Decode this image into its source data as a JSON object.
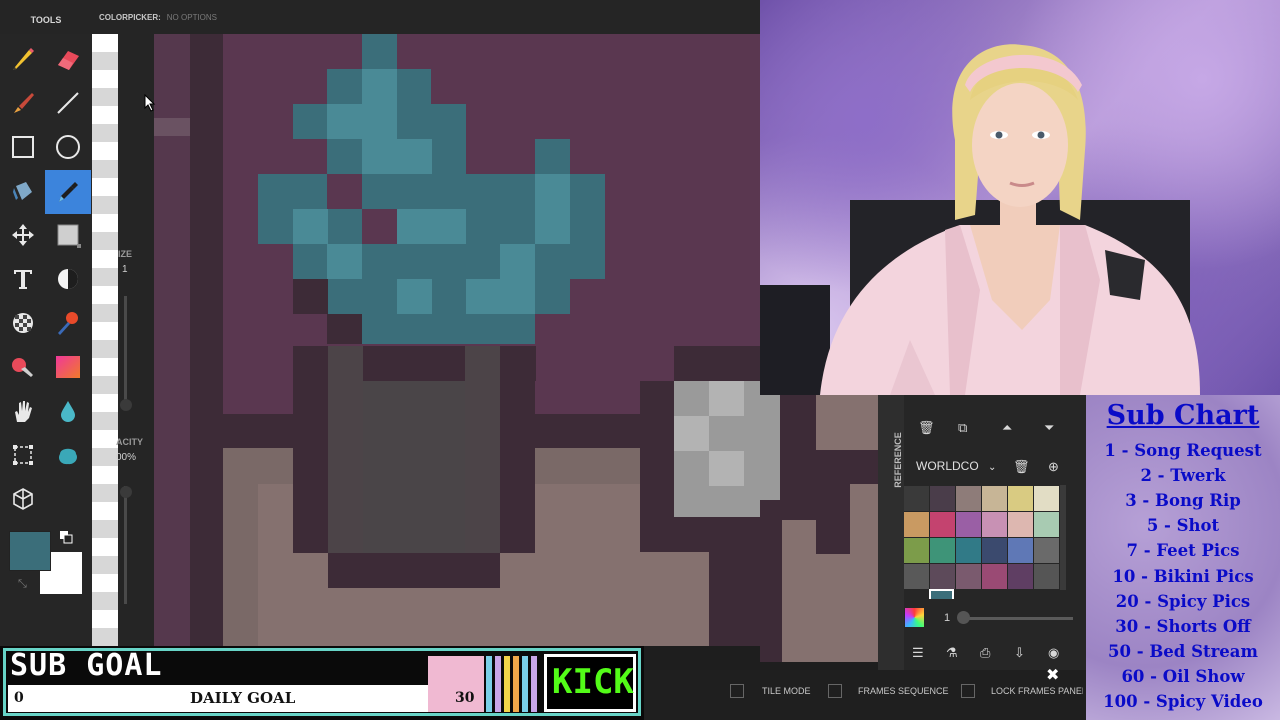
{
  "editor": {
    "tools_title": "TOOLS",
    "tool_option_name": "COLORPICKER:",
    "tool_option_value": "NO OPTIONS",
    "size_label": "IZE",
    "size_value": "1",
    "opacity_label": "ACITY",
    "opacity_value": "00%",
    "primary_color": "#3b6e7a",
    "secondary_color": "#ffffff",
    "tools": [
      "pencil-icon",
      "eraser-icon",
      "brush-icon",
      "line-icon",
      "rectangle-icon",
      "ellipse-icon",
      "fill-bucket-icon",
      "color-picker-icon",
      "move-icon",
      "selection-rect-icon",
      "text-icon",
      "dither-icon",
      "checker-icon",
      "stamp-icon",
      "paint-icon",
      "gradient-icon",
      "hand-icon",
      "droplet-icon",
      "crop-icon",
      "blob-icon",
      "cube-icon"
    ],
    "active_tool": "color-picker-icon"
  },
  "panel": {
    "reference_tab": "REFERENCE",
    "palette_name": "WORLDCO",
    "frame_count": "1",
    "swatches": [
      "#3a3a3a",
      "#4a3d4a",
      "#8e7c79",
      "#c7b596",
      "#d9cb82",
      "#e2ddc5",
      "#c99a62",
      "#c4436f",
      "#9a5fa5",
      "#c891b4",
      "#ddb7b0",
      "#a8cbb2",
      "#7c9c4a",
      "#3e9478",
      "#317a87",
      "#3b4a6e",
      "#5f78b6",
      "#6a6a6a",
      "#595959",
      "#5d4a5a",
      "#7a5a6e",
      "#9a4a74",
      "#5f3e63",
      "#555555"
    ]
  },
  "bottom_options": {
    "tile_mode": "TILE MODE",
    "frames_sequence": "FRAMES SEQUENCE",
    "lock_frames": "LOCK FRAMES PANEL"
  },
  "sub_chart": {
    "title": "Sub Chart",
    "items": [
      "1 - Song Request",
      "2 - Twerk",
      "3 - Bong Rip",
      "5 - Shot",
      "7 - Feet Pics",
      "10 - Bikini Pics",
      "20 - Spicy Pics",
      "30 - Shorts Off",
      "50 - Bed Stream",
      "60 - Oil Show",
      "100 - Spicy Video"
    ]
  },
  "sub_goal": {
    "title": "SUB GOAL",
    "current": "0",
    "label": "DAILY GOAL",
    "target": "30",
    "platform": "KICK"
  }
}
